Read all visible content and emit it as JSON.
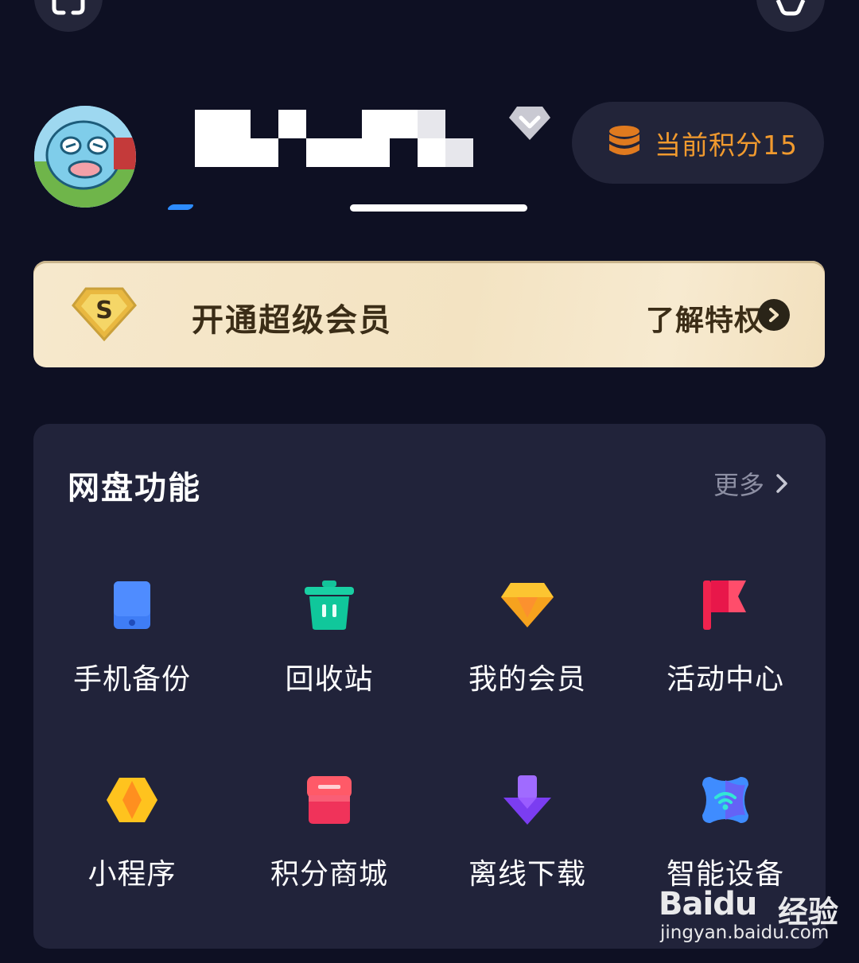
{
  "top_bar": {
    "scan_icon": "scan-icon",
    "settings_icon": "settings-icon"
  },
  "profile": {
    "avatar_icon": "avatar",
    "points_label": "当前积分15",
    "points_icon": "coins-icon"
  },
  "vip_banner": {
    "badge_text": "S",
    "title": "开通超级会员",
    "link": "了解特权"
  },
  "features": {
    "title": "网盘功能",
    "more": "更多",
    "items": [
      {
        "label": "手机备份",
        "icon": "phone-icon"
      },
      {
        "label": "回收站",
        "icon": "trash-icon"
      },
      {
        "label": "我的会员",
        "icon": "diamond-icon"
      },
      {
        "label": "活动中心",
        "icon": "flag-icon"
      },
      {
        "label": "小程序",
        "icon": "mini-program-icon"
      },
      {
        "label": "积分商城",
        "icon": "store-icon"
      },
      {
        "label": "离线下载",
        "icon": "download-icon"
      },
      {
        "label": "智能设备",
        "icon": "smart-device-icon"
      }
    ]
  },
  "watermark": {
    "brand": "Baidu",
    "brand_cn": "经验",
    "url": "jingyan.baidu.com"
  },
  "colors": {
    "background": "#0e1023",
    "card": "#21233a",
    "points_text": "#f19a2e",
    "vip_gold": "#f6e8cc"
  }
}
